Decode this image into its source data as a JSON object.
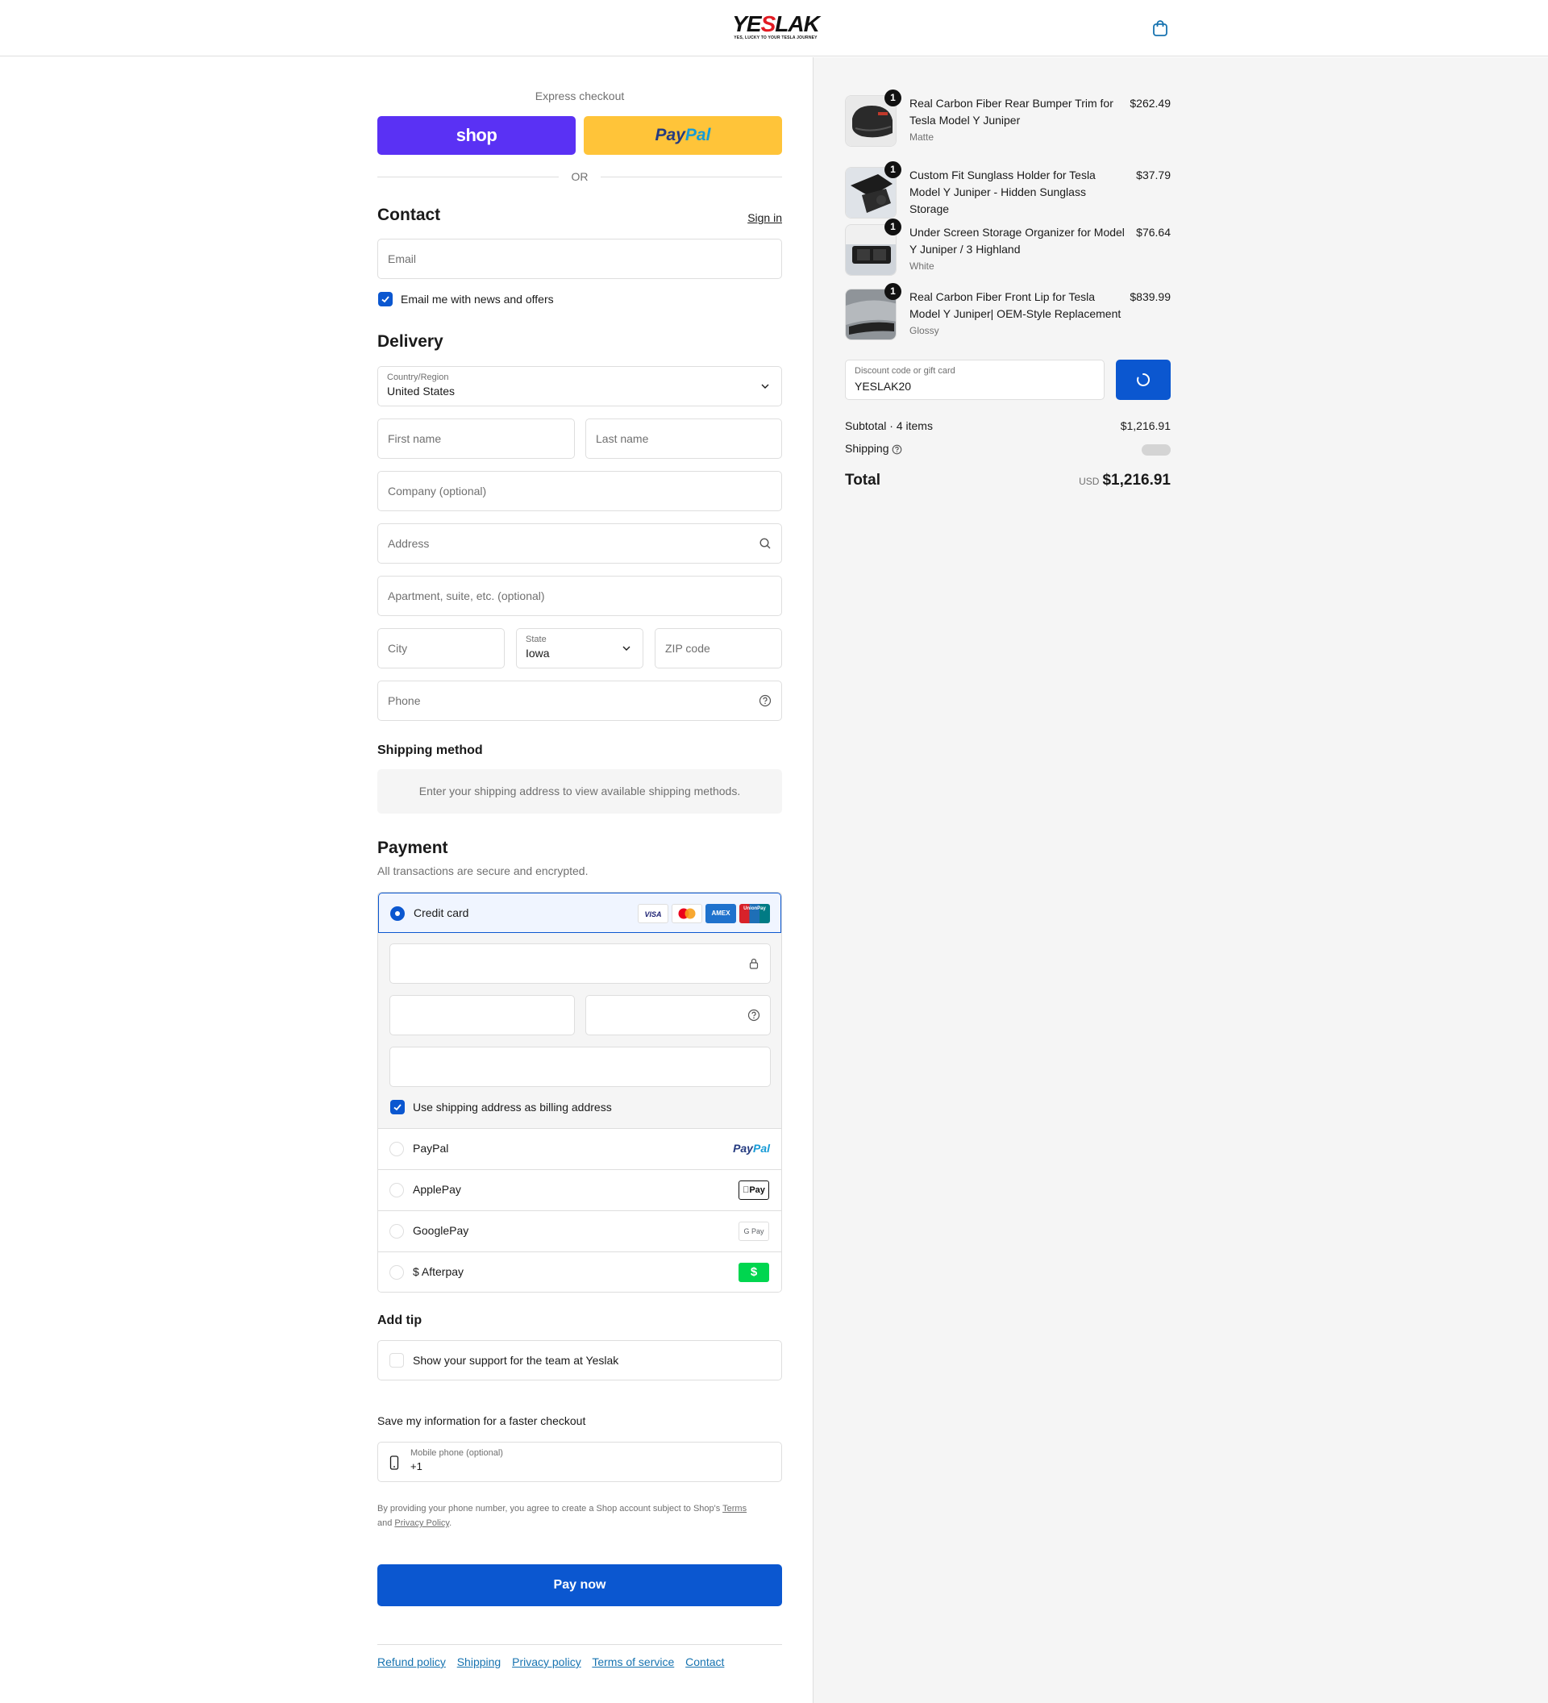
{
  "header": {
    "logo_text_a": "YE",
    "logo_text_bolt": "S",
    "logo_text_b": "LAK",
    "logo_tagline": "YES, LUCKY TO YOUR TESLA JOURNEY",
    "cart_icon": "shopping-bag-icon"
  },
  "express": {
    "label": "Express checkout",
    "shop_label": "shop",
    "paypal_a": "Pay",
    "paypal_b": "Pal",
    "or": "OR"
  },
  "contact": {
    "title": "Contact",
    "sign_in": "Sign in",
    "email_placeholder": "Email",
    "newsletter_label": "Email me with news and offers"
  },
  "delivery": {
    "title": "Delivery",
    "country_label": "Country/Region",
    "country_value": "United States",
    "first_name": "First name",
    "last_name": "Last name",
    "company": "Company (optional)",
    "address": "Address",
    "apartment": "Apartment, suite, etc. (optional)",
    "city": "City",
    "state_label": "State",
    "state_value": "Iowa",
    "zip": "ZIP code",
    "phone": "Phone"
  },
  "shipping_method": {
    "title": "Shipping method",
    "message": "Enter your shipping address to view available shipping methods."
  },
  "payment": {
    "title": "Payment",
    "subtitle": "All transactions are secure and encrypted.",
    "credit_card_label": "Credit card",
    "card_brands": [
      "VISA",
      "MC",
      "AMEX",
      "UnionPay"
    ],
    "billing_label": "Use shipping address as billing address",
    "methods": [
      {
        "label": "PayPal",
        "badge_a": "Pay",
        "badge_b": "Pal"
      },
      {
        "label": "ApplePay",
        "badge": "Pay"
      },
      {
        "label": "GooglePay",
        "badge": "G Pay"
      },
      {
        "label": "$ Afterpay",
        "badge": "$"
      }
    ]
  },
  "tip": {
    "title": "Add tip",
    "label": "Show your support for the team at Yeslak"
  },
  "save_info": {
    "title": "Save my information for a faster checkout",
    "phone_label": "Mobile phone (optional)",
    "phone_value": "+1",
    "legal_a": "By providing your phone number, you agree to create a Shop account subject to Shop's ",
    "legal_terms": "Terms",
    "legal_and": "and ",
    "legal_privacy": "Privacy Policy",
    "legal_end": "."
  },
  "pay_now": "Pay now",
  "footer": [
    "Refund policy",
    "Shipping",
    "Privacy policy",
    "Terms of service",
    "Contact"
  ],
  "order": {
    "items": [
      {
        "qty": "1",
        "name": "Real Carbon Fiber Rear Bumper Trim for Tesla Model Y Juniper",
        "variant": "Matte",
        "price": "$262.49"
      },
      {
        "qty": "1",
        "name": "Custom Fit Sunglass Holder for Tesla Model Y Juniper - Hidden Sunglass Storage",
        "variant": "",
        "price": "$37.79"
      },
      {
        "qty": "1",
        "name": "Under Screen Storage Organizer for Model Y Juniper / 3 Highland",
        "variant": "White",
        "price": "$76.64"
      },
      {
        "qty": "1",
        "name": "Real Carbon Fiber Front Lip for Tesla Model Y Juniper| OEM-Style Replacement",
        "variant": "Glossy",
        "price": "$839.99"
      }
    ],
    "discount_label": "Discount code or gift card",
    "discount_value": "YESLAK20",
    "subtotal_label": "Subtotal · 4 items",
    "subtotal_value": "$1,216.91",
    "shipping_label": "Shipping",
    "total_label": "Total",
    "currency": "USD",
    "total_value": "$1,216.91"
  },
  "colors": {
    "accent": "#0b57d0",
    "shop": "#5a31f4",
    "paypal": "#ffc439",
    "link": "#1773b0"
  }
}
